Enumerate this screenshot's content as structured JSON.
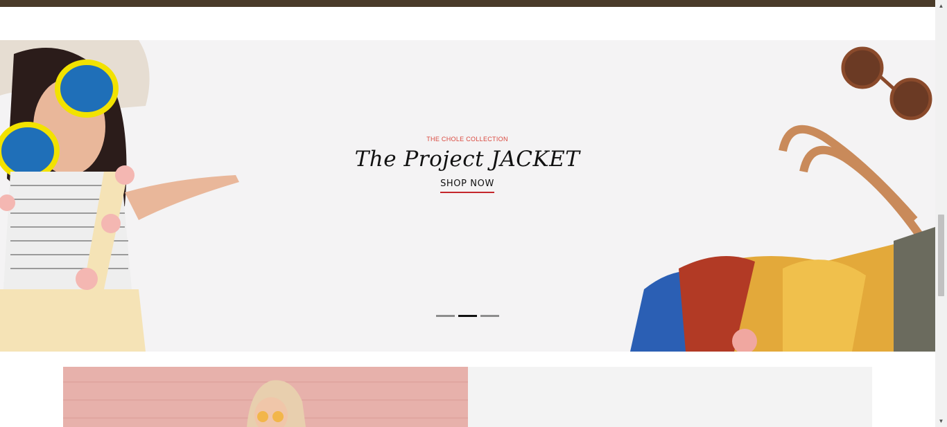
{
  "hero": {
    "eyebrow": "THE CHOLE COLLECTION",
    "title": "The Project JACKET",
    "cta": "SHOP NOW",
    "slides": 3,
    "active_slide": 2
  },
  "colors": {
    "top_bar": "#4a3b29",
    "hero_bg": "#f4f3f4",
    "accent": "#c4262b",
    "eyebrow": "#d9463c",
    "promo_pink": "#e7b1ab",
    "promo_grey": "#f3f3f3"
  },
  "icons": {
    "scroll_up": "chevron-up-icon",
    "scroll_down": "chevron-down-icon"
  }
}
